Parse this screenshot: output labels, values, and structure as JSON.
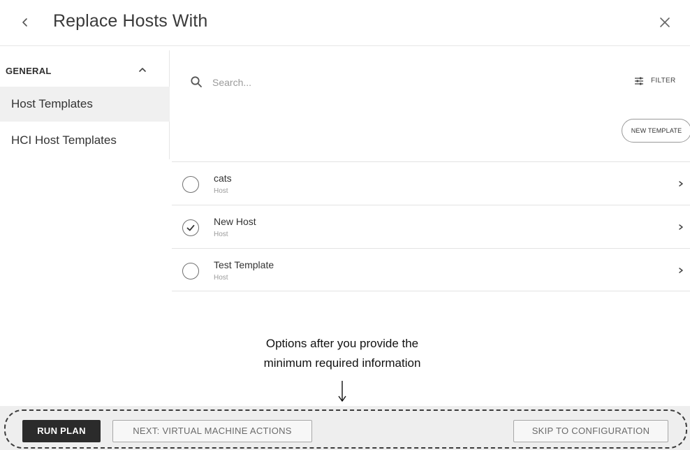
{
  "header": {
    "title": "Replace Hosts With",
    "back_icon": "chevron-left-icon",
    "close_icon": "close-icon"
  },
  "sidebar": {
    "group_label": "GENERAL",
    "group_icon": "chevron-up-icon",
    "items": [
      {
        "label": "Host Templates",
        "active": true
      },
      {
        "label": "HCI Host Templates",
        "active": false
      }
    ]
  },
  "search": {
    "placeholder": "Search...",
    "value": "",
    "icon": "search-icon"
  },
  "filter": {
    "label": "FILTER",
    "icon": "filter-sliders-icon"
  },
  "new_template_label": "NEW TEMPLATE",
  "templates": [
    {
      "name": "cats",
      "type": "Host",
      "selected": false
    },
    {
      "name": "New Host",
      "type": "Host",
      "selected": true
    },
    {
      "name": "Test Template",
      "type": "Host",
      "selected": false
    }
  ],
  "annotation": {
    "line1": "Options after you provide the",
    "line2": "minimum required information"
  },
  "footer": {
    "run_plan_label": "RUN PLAN",
    "next_label": "NEXT: VIRTUAL MACHINE ACTIONS",
    "skip_label": "SKIP TO CONFIGURATION"
  },
  "colors": {
    "primary_button": "#2b2b2b",
    "footer_background": "#eeeeee",
    "active_sidebar": "#f0f0f0"
  }
}
